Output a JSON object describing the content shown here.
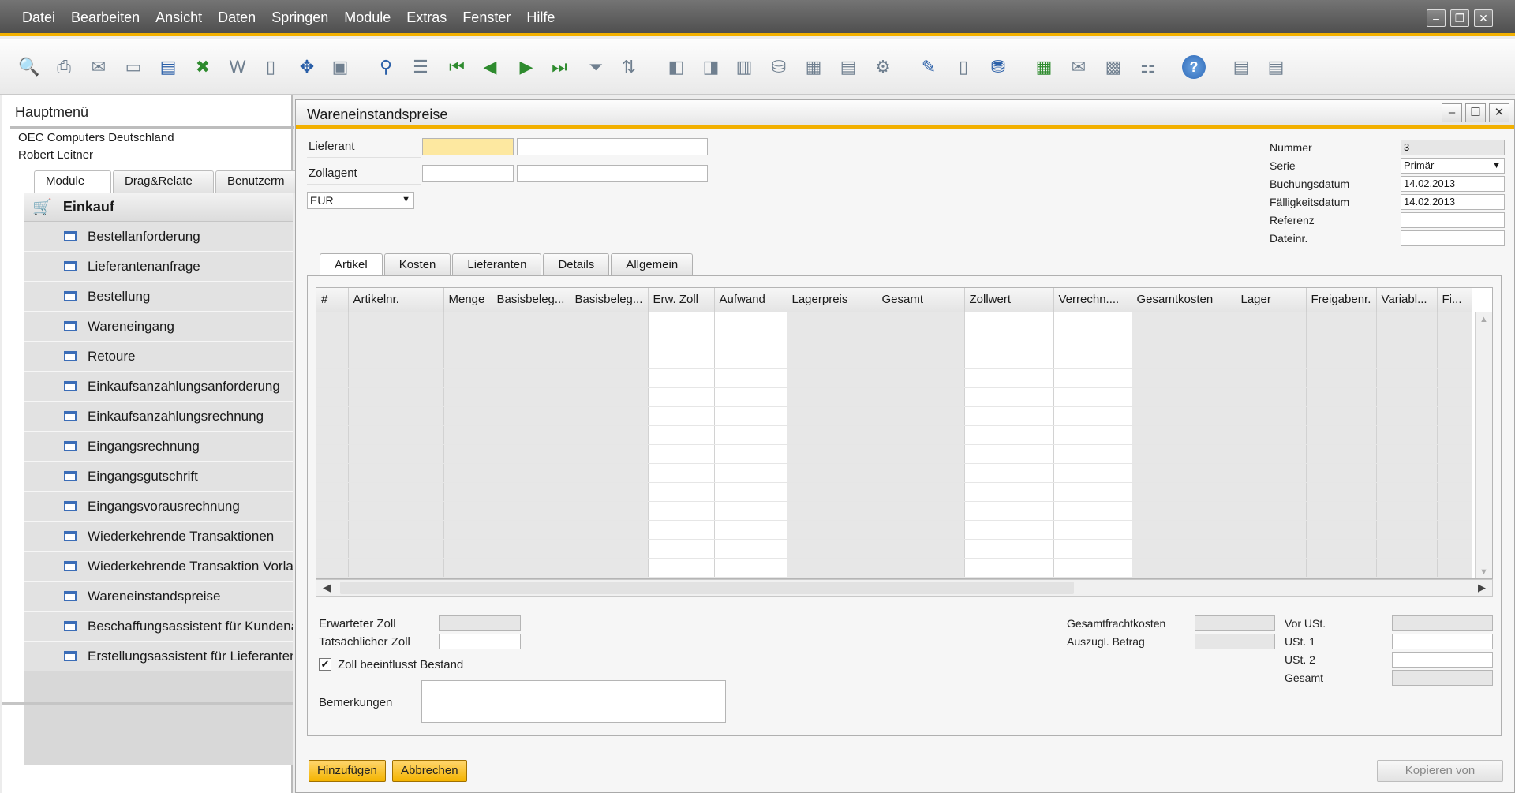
{
  "menubar": {
    "items": [
      "Datei",
      "Bearbeiten",
      "Ansicht",
      "Daten",
      "Springen",
      "Module",
      "Extras",
      "Fenster",
      "Hilfe"
    ]
  },
  "main_menu": {
    "title": "Hauptmenü",
    "company": "OEC Computers Deutschland",
    "user": "Robert Leitner",
    "tabs": [
      "Module",
      "Drag&Relate",
      "Benutzerm"
    ],
    "category": "Einkauf",
    "items": [
      "Bestellanforderung",
      "Lieferantenanfrage",
      "Bestellung",
      "Wareneingang",
      "Retoure",
      "Einkaufsanzahlungsanforderung",
      "Einkaufsanzahlungsrechnung",
      "Eingangsrechnung",
      "Eingangsgutschrift",
      "Eingangsvorausrechnung",
      "Wiederkehrende Transaktionen",
      "Wiederkehrende Transaktion Vorlag",
      "Wareneinstandspreise",
      "Beschaffungsassistent für Kundena",
      "Erstellungsassistent für Lieferanten"
    ]
  },
  "doc": {
    "title": "Wareneinstandspreise",
    "lieferant_label": "Lieferant",
    "zollagent_label": "Zollagent",
    "currency": "EUR",
    "nummer_label": "Nummer",
    "nummer_value": "3",
    "serie_label": "Serie",
    "serie_value": "Primär",
    "buchungsdatum_label": "Buchungsdatum",
    "buchungsdatum_value": "14.02.2013",
    "faelligkeitsdatum_label": "Fälligkeitsdatum",
    "faelligkeitsdatum_value": "14.02.2013",
    "referenz_label": "Referenz",
    "dateinr_label": "Dateinr.",
    "tabs": [
      "Artikel",
      "Kosten",
      "Lieferanten",
      "Details",
      "Allgemein"
    ],
    "grid_columns": [
      "#",
      "Artikelnr.",
      "Menge",
      "Basisbeleg...",
      "Basisbeleg...",
      "Erw. Zoll",
      "Aufwand",
      "Lagerpreis",
      "Gesamt",
      "Zollwert",
      "Verrechn....",
      "Gesamtkosten",
      "Lager",
      "Freigabenr.",
      "Variabl...",
      "Fi..."
    ],
    "erwarteter_zoll_label": "Erwarteter Zoll",
    "tatsaechlicher_zoll_label": "Tatsächlicher Zoll",
    "zoll_bestand_label": "Zoll beeinflusst Bestand",
    "zoll_bestand_checked": true,
    "bemerkungen_label": "Bemerkungen",
    "gesamtfrachtkosten_label": "Gesamtfrachtkosten",
    "auszugl_betrag_label": "Auszugl. Betrag",
    "vor_ust_label": "Vor USt.",
    "ust1_label": "USt. 1",
    "ust2_label": "USt. 2",
    "gesamt_label": "Gesamt",
    "add_button": "Hinzufügen",
    "cancel_button": "Abbrechen",
    "copy_from_button": "Kopieren von"
  },
  "toolbar_icons": [
    "preview-icon",
    "print-icon",
    "email-icon",
    "sms-icon",
    "fax-icon",
    "excel-icon",
    "word-icon",
    "pdf-icon",
    "move-icon",
    "lock-icon",
    "find-icon",
    "add-icon",
    "first-record-icon",
    "previous-record-icon",
    "next-record-icon",
    "last-record-icon",
    "filter-icon",
    "sort-icon",
    "base-document-icon",
    "target-document-icon",
    "gross-profit-icon",
    "transaction-journal-icon",
    "payment-means-icon",
    "volume-weight-icon",
    "settings-icon",
    "report-icon",
    "edit-form-icon",
    "new-document-icon",
    "database-icon",
    "calendar-icon",
    "message-icon",
    "alerts-icon",
    "org-chart-icon",
    "help-icon",
    "layout-icon",
    "query-icon"
  ],
  "colors": {
    "accent": "#f2b000",
    "menubar": "#5e5e5e",
    "mandatory_field": "#fde8a0"
  }
}
